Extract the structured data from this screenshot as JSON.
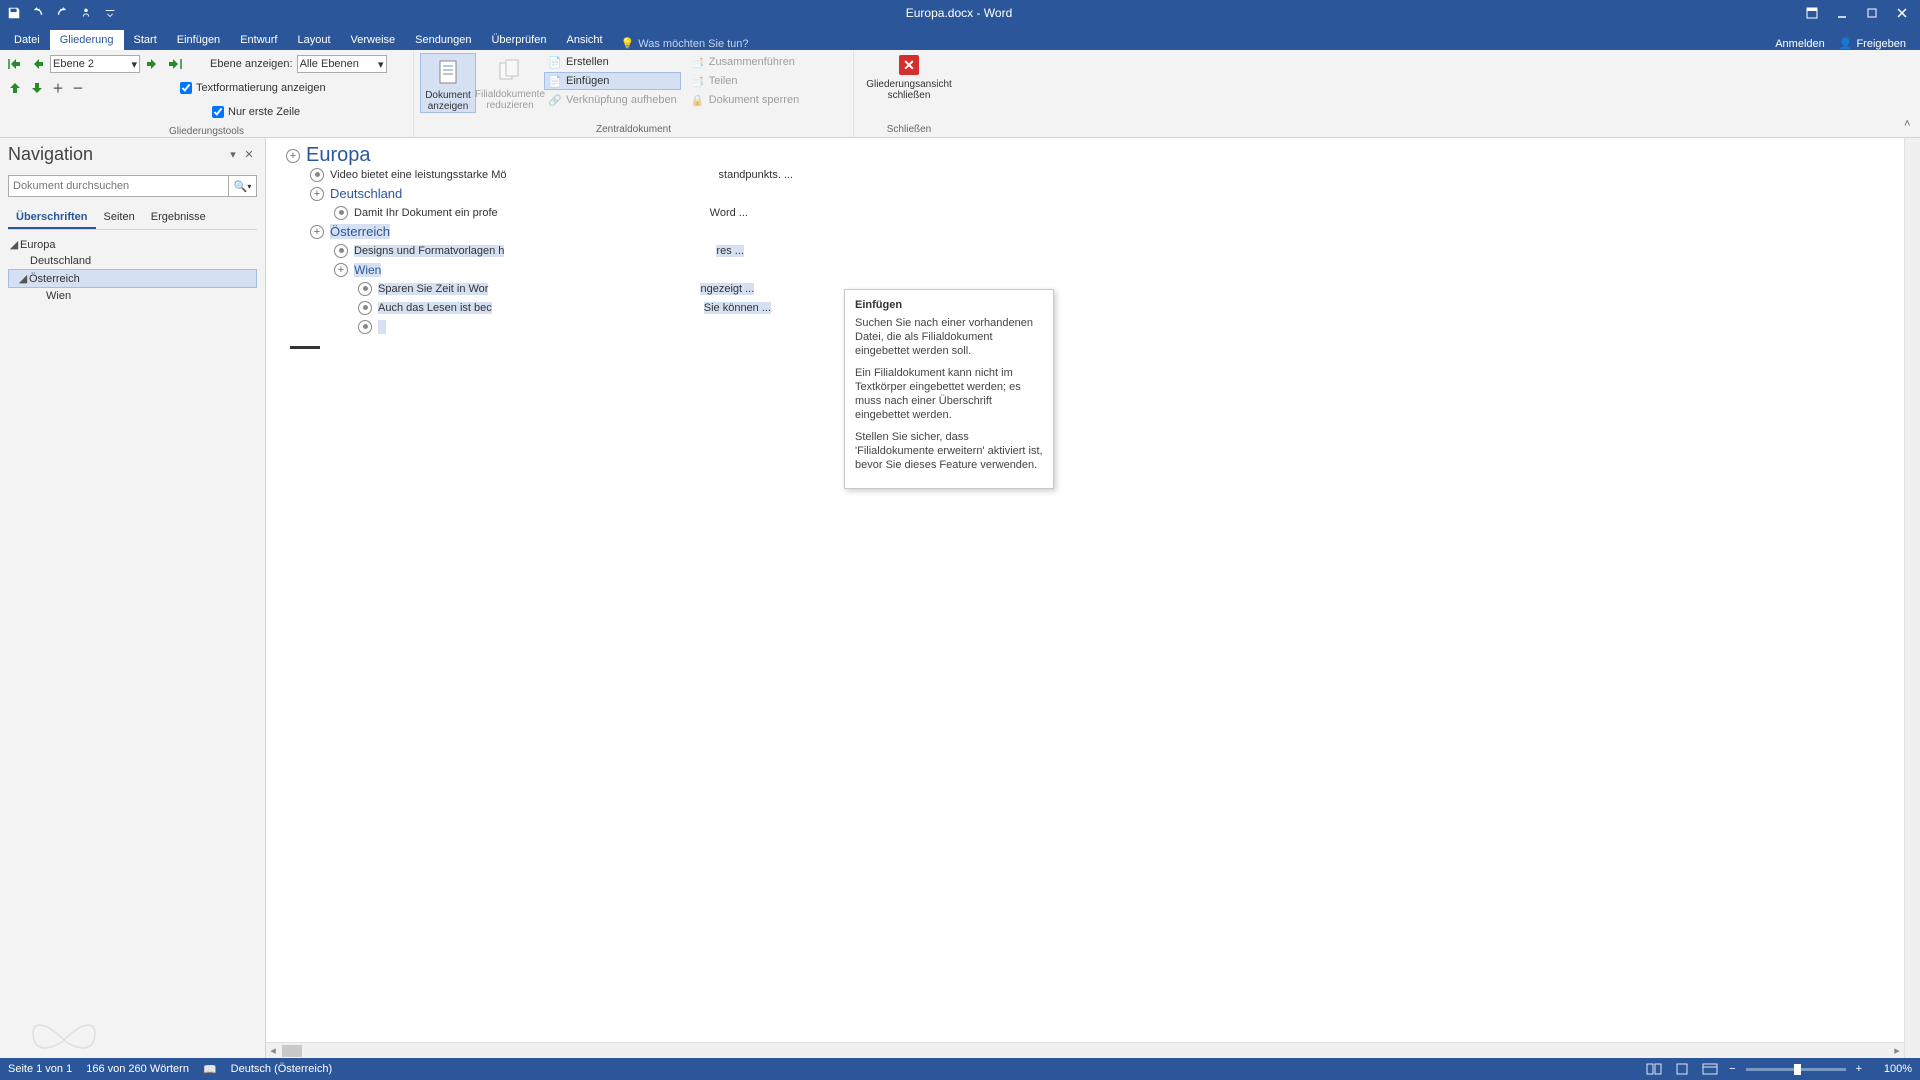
{
  "titlebar": {
    "title": "Europa.docx - Word"
  },
  "tabs": {
    "file": "Datei",
    "context": "Gliederung",
    "start": "Start",
    "insert": "Einfügen",
    "design": "Entwurf",
    "layout": "Layout",
    "references": "Verweise",
    "mailings": "Sendungen",
    "review": "Überprüfen",
    "view": "Ansicht",
    "tellme": "Was möchten Sie tun?",
    "signin": "Anmelden",
    "share": "Freigeben"
  },
  "ribbon": {
    "outline_tools_label": "Gliederungstools",
    "level_value": "Ebene 2",
    "show_label": "Ebene anzeigen:",
    "show_value": "Alle Ebenen",
    "chk_textfmt": "Textformatierung anzeigen",
    "chk_firstline": "Nur erste Zeile",
    "master_label": "Zentraldokument",
    "show_doc": "Dokument anzeigen",
    "reduce_subs": "Filialdokumente reduzieren",
    "create": "Erstellen",
    "insert": "Einfügen",
    "unlink": "Verknüpfung aufheben",
    "merge": "Zusammenführen",
    "split": "Teilen",
    "lock": "Dokument sperren",
    "close_label_group": "Schließen",
    "close_view": "Gliederungsansicht schließen"
  },
  "nav": {
    "title": "Navigation",
    "search_placeholder": "Dokument durchsuchen",
    "tab_headings": "Überschriften",
    "tab_pages": "Seiten",
    "tab_results": "Ergebnisse",
    "tree": {
      "europa": "Europa",
      "deutschland": "Deutschland",
      "oesterreich": "Österreich",
      "wien": "Wien"
    }
  },
  "outline": {
    "europa": "Europa",
    "body1": "Video bietet eine leistungsstarke Mö",
    "body1_tail": "standpunkts. ...",
    "deutschland": "Deutschland",
    "body2": "Damit Ihr Dokument ein profe",
    "body2_tail": "Word ...",
    "oesterreich": "Österreich",
    "body3": "Designs und Formatvorlagen h",
    "body3_tail": "res ...",
    "wien": "Wien",
    "body4": "Sparen Sie Zeit in Wor",
    "body4_tail": "ngezeigt ...",
    "body5": "Auch das Lesen ist bec",
    "body5_tail": "Sie können ..."
  },
  "tooltip": {
    "title": "Einfügen",
    "p1": "Suchen Sie nach einer vorhandenen Datei, die als Filialdokument eingebettet werden soll.",
    "p2": "Ein Filialdokument kann nicht im Textkörper eingebettet werden; es muss nach einer Überschrift eingebettet werden.",
    "p3": "Stellen Sie sicher, dass 'Filialdokumente erweitern' aktiviert ist, bevor Sie dieses Feature verwenden."
  },
  "status": {
    "page": "Seite 1 von 1",
    "words": "166 von 260 Wörtern",
    "lang": "Deutsch (Österreich)",
    "zoom": "100%"
  }
}
